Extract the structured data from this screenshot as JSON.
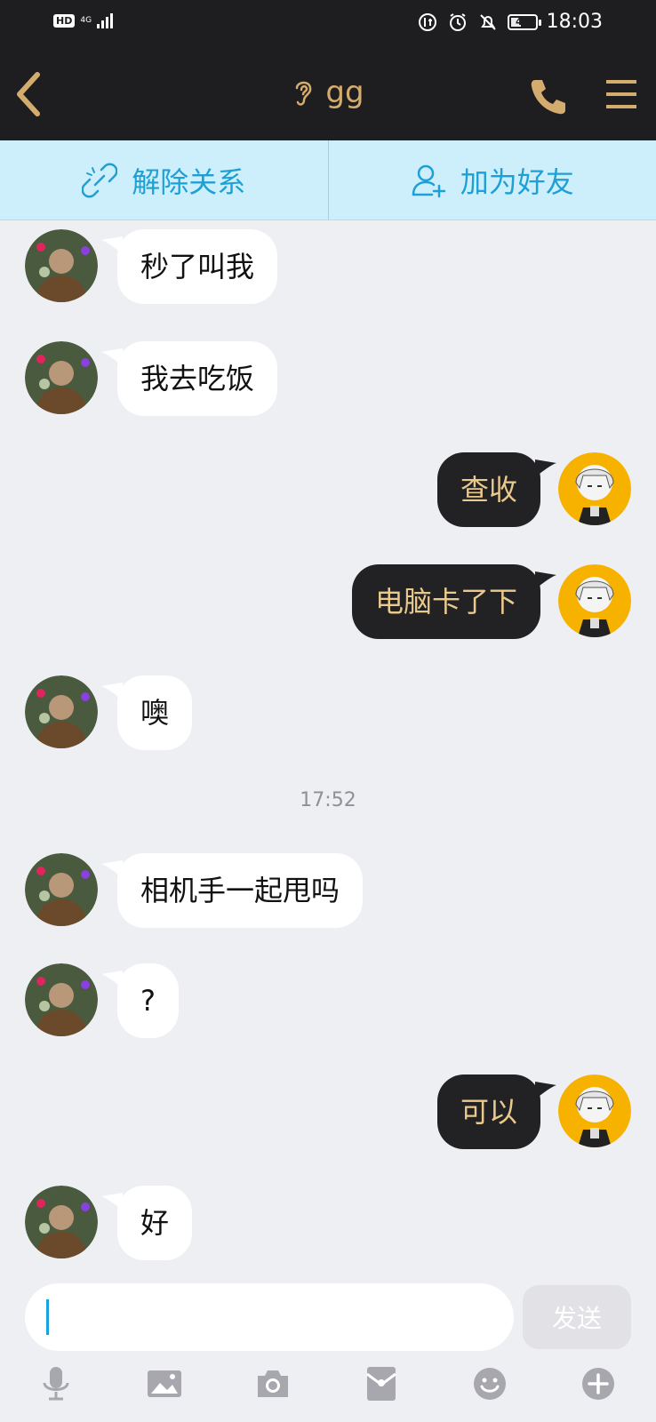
{
  "status_bar": {
    "hd": "HD",
    "net": "4G",
    "battery": "41",
    "battery_fraction": 0.41,
    "time": "18:03"
  },
  "header": {
    "title": "gg",
    "back_icon": "chevron-left-icon",
    "mode_icon": "ear-icon",
    "call_icon": "phone-icon",
    "menu_icon": "menu-icon"
  },
  "actions": {
    "unbind": "解除关系",
    "add_friend": "加为好友"
  },
  "messages": [
    {
      "side": "left",
      "text": "秒了叫我"
    },
    {
      "side": "left",
      "text": "我去吃饭"
    },
    {
      "side": "right",
      "text": "查收"
    },
    {
      "side": "right",
      "text": "电脑卡了下"
    },
    {
      "side": "left",
      "text": "噢"
    },
    {
      "side": "left",
      "text": "相机手一起甩吗"
    },
    {
      "side": "left",
      "text": "?"
    },
    {
      "side": "right",
      "text": "可以"
    },
    {
      "side": "left",
      "text": "好"
    }
  ],
  "timestamp": "17:52",
  "composer": {
    "value": "",
    "send_label": "发送"
  },
  "toolbar": [
    "microphone-icon",
    "image-icon",
    "camera-icon",
    "red-packet-icon",
    "emoji-icon",
    "plus-icon"
  ],
  "colors": {
    "header_bg": "#1e1e20",
    "accent_gold": "#d4ac6e",
    "action_bg": "#cdeefb",
    "action_text": "#1fa0d4",
    "chat_bg": "#eeeff3",
    "outgoing_bubble": "#222224"
  }
}
